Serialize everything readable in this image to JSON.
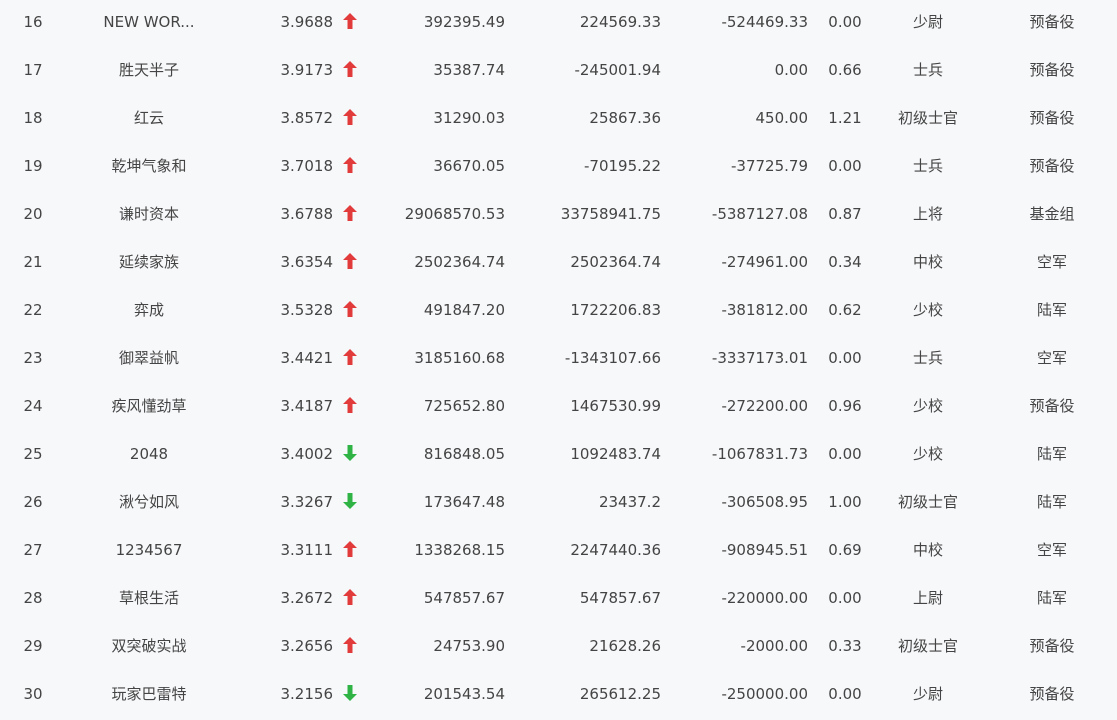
{
  "rows": [
    {
      "rank": "16",
      "name": "NEW WOR...",
      "score": "3.9688",
      "trend": "up",
      "v1": "392395.49",
      "v2": "224569.33",
      "v3": "-524469.33",
      "ratio": "0.00",
      "level": "少尉",
      "group": "预备役"
    },
    {
      "rank": "17",
      "name": "胜天半子",
      "score": "3.9173",
      "trend": "up",
      "v1": "35387.74",
      "v2": "-245001.94",
      "v3": "0.00",
      "ratio": "0.66",
      "level": "士兵",
      "group": "预备役"
    },
    {
      "rank": "18",
      "name": "红云",
      "score": "3.8572",
      "trend": "up",
      "v1": "31290.03",
      "v2": "25867.36",
      "v3": "450.00",
      "ratio": "1.21",
      "level": "初级士官",
      "group": "预备役"
    },
    {
      "rank": "19",
      "name": "乾坤气象和",
      "score": "3.7018",
      "trend": "up",
      "v1": "36670.05",
      "v2": "-70195.22",
      "v3": "-37725.79",
      "ratio": "0.00",
      "level": "士兵",
      "group": "预备役"
    },
    {
      "rank": "20",
      "name": "谦时资本",
      "score": "3.6788",
      "trend": "up",
      "v1": "29068570.53",
      "v2": "33758941.75",
      "v3": "-5387127.08",
      "ratio": "0.87",
      "level": "上将",
      "group": "基金组"
    },
    {
      "rank": "21",
      "name": "延续家族",
      "score": "3.6354",
      "trend": "up",
      "v1": "2502364.74",
      "v2": "2502364.74",
      "v3": "-274961.00",
      "ratio": "0.34",
      "level": "中校",
      "group": "空军"
    },
    {
      "rank": "22",
      "name": "弈成",
      "score": "3.5328",
      "trend": "up",
      "v1": "491847.20",
      "v2": "1722206.83",
      "v3": "-381812.00",
      "ratio": "0.62",
      "level": "少校",
      "group": "陆军"
    },
    {
      "rank": "23",
      "name": "御翠益帆",
      "score": "3.4421",
      "trend": "up",
      "v1": "3185160.68",
      "v2": "-1343107.66",
      "v3": "-3337173.01",
      "ratio": "0.00",
      "level": "士兵",
      "group": "空军"
    },
    {
      "rank": "24",
      "name": "疾风懂劲草",
      "score": "3.4187",
      "trend": "up",
      "v1": "725652.80",
      "v2": "1467530.99",
      "v3": "-272200.00",
      "ratio": "0.96",
      "level": "少校",
      "group": "预备役"
    },
    {
      "rank": "25",
      "name": "2048",
      "score": "3.4002",
      "trend": "down",
      "v1": "816848.05",
      "v2": "1092483.74",
      "v3": "-1067831.73",
      "ratio": "0.00",
      "level": "少校",
      "group": "陆军"
    },
    {
      "rank": "26",
      "name": "湫兮如风",
      "score": "3.3267",
      "trend": "down",
      "v1": "173647.48",
      "v2": "23437.2",
      "v3": "-306508.95",
      "ratio": "1.00",
      "level": "初级士官",
      "group": "陆军"
    },
    {
      "rank": "27",
      "name": "1234567",
      "score": "3.3111",
      "trend": "up",
      "v1": "1338268.15",
      "v2": "2247440.36",
      "v3": "-908945.51",
      "ratio": "0.69",
      "level": "中校",
      "group": "空军"
    },
    {
      "rank": "28",
      "name": "草根生活",
      "score": "3.2672",
      "trend": "up",
      "v1": "547857.67",
      "v2": "547857.67",
      "v3": "-220000.00",
      "ratio": "0.00",
      "level": "上尉",
      "group": "陆军"
    },
    {
      "rank": "29",
      "name": "双突破实战",
      "score": "3.2656",
      "trend": "up",
      "v1": "24753.90",
      "v2": "21628.26",
      "v3": "-2000.00",
      "ratio": "0.33",
      "level": "初级士官",
      "group": "预备役"
    },
    {
      "rank": "30",
      "name": "玩家巴雷特",
      "score": "3.2156",
      "trend": "down",
      "v1": "201543.54",
      "v2": "265612.25",
      "v3": "-250000.00",
      "ratio": "0.00",
      "level": "少尉",
      "group": "预备役"
    }
  ],
  "colors": {
    "up": "#e23b3b",
    "down": "#2fb344",
    "text": "#444444"
  }
}
